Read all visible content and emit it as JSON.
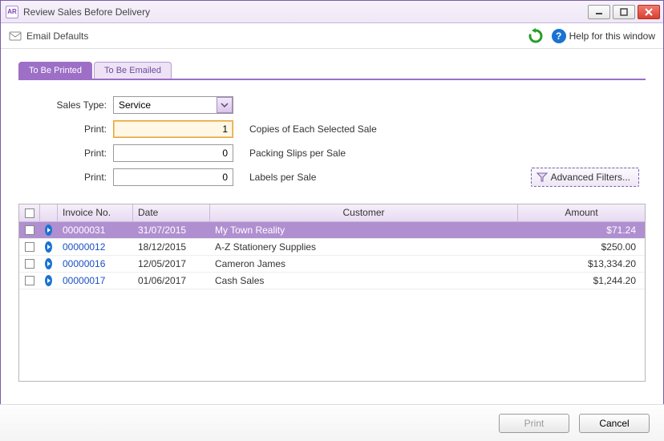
{
  "window": {
    "title": "Review Sales Before Delivery"
  },
  "toolbar": {
    "email_defaults_label": "Email Defaults",
    "help_label": "Help for this window"
  },
  "tabs": [
    {
      "label": "To Be Printed",
      "active": true
    },
    {
      "label": "To Be Emailed",
      "active": false
    }
  ],
  "form": {
    "sales_type_label": "Sales Type:",
    "sales_type_value": "Service",
    "print_label": "Print:",
    "copies_value": "1",
    "copies_desc": "Copies of Each Selected Sale",
    "packing_value": "0",
    "packing_desc": "Packing Slips per Sale",
    "labels_value": "0",
    "labels_desc": "Labels per Sale",
    "advanced_filters_label": "Advanced Filters..."
  },
  "grid": {
    "headers": {
      "invoice_no": "Invoice No.",
      "date": "Date",
      "customer": "Customer",
      "amount": "Amount"
    },
    "rows": [
      {
        "invoice_no": "00000031",
        "date": "31/07/2015",
        "customer": "My Town Reality",
        "amount": "$71.24",
        "selected": true
      },
      {
        "invoice_no": "00000012",
        "date": "18/12/2015",
        "customer": "A-Z Stationery Supplies",
        "amount": "$250.00",
        "selected": false
      },
      {
        "invoice_no": "00000016",
        "date": "12/05/2017",
        "customer": "Cameron James",
        "amount": "$13,334.20",
        "selected": false
      },
      {
        "invoice_no": "00000017",
        "date": "01/06/2017",
        "customer": "Cash Sales",
        "amount": "$1,244.20",
        "selected": false
      }
    ]
  },
  "footer": {
    "print_label": "Print",
    "cancel_label": "Cancel"
  }
}
